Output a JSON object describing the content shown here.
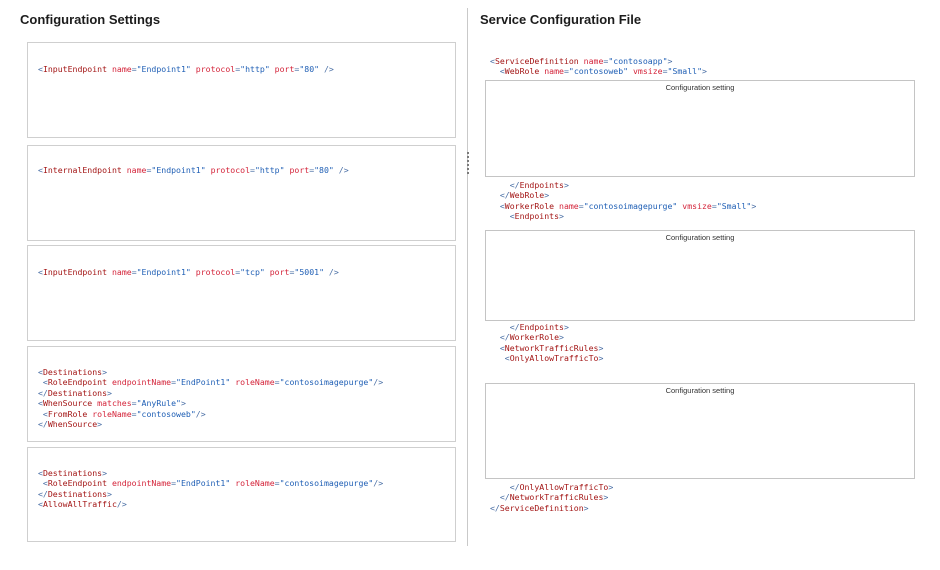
{
  "left_panel": {
    "title": "Configuration Settings",
    "tiles": [
      {
        "lines": [
          [
            {
              "c": "p",
              "t": "<"
            },
            {
              "c": "t",
              "t": "InputEndpoint"
            },
            {
              "c": "a",
              "t": " name"
            },
            {
              "c": "p",
              "t": "="
            },
            {
              "c": "v",
              "t": "\"Endpoint1\""
            },
            {
              "c": "a",
              "t": " protocol"
            },
            {
              "c": "p",
              "t": "="
            },
            {
              "c": "v",
              "t": "\"http\""
            },
            {
              "c": "a",
              "t": " port"
            },
            {
              "c": "p",
              "t": "="
            },
            {
              "c": "v",
              "t": "\"80\""
            },
            {
              "c": "p",
              "t": " />"
            }
          ]
        ]
      },
      {
        "lines": [
          [
            {
              "c": "p",
              "t": "<"
            },
            {
              "c": "t",
              "t": "InternalEndpoint"
            },
            {
              "c": "a",
              "t": " name"
            },
            {
              "c": "p",
              "t": "="
            },
            {
              "c": "v",
              "t": "\"Endpoint1\""
            },
            {
              "c": "a",
              "t": " protocol"
            },
            {
              "c": "p",
              "t": "="
            },
            {
              "c": "v",
              "t": "\"http\""
            },
            {
              "c": "a",
              "t": " port"
            },
            {
              "c": "p",
              "t": "="
            },
            {
              "c": "v",
              "t": "\"80\""
            },
            {
              "c": "p",
              "t": " />"
            }
          ]
        ]
      },
      {
        "lines": [
          [
            {
              "c": "p",
              "t": "<"
            },
            {
              "c": "t",
              "t": "InputEndpoint"
            },
            {
              "c": "a",
              "t": " name"
            },
            {
              "c": "p",
              "t": "="
            },
            {
              "c": "v",
              "t": "\"Endpoint1\""
            },
            {
              "c": "a",
              "t": " protocol"
            },
            {
              "c": "p",
              "t": "="
            },
            {
              "c": "v",
              "t": "\"tcp\""
            },
            {
              "c": "a",
              "t": " port"
            },
            {
              "c": "p",
              "t": "="
            },
            {
              "c": "v",
              "t": "\"5001\""
            },
            {
              "c": "p",
              "t": " />"
            }
          ]
        ]
      },
      {
        "lines": [
          [
            {
              "c": "p",
              "t": "<"
            },
            {
              "c": "t",
              "t": "Destinations"
            },
            {
              "c": "p",
              "t": ">"
            }
          ],
          [
            {
              "c": "p",
              "t": " <"
            },
            {
              "c": "t",
              "t": "RoleEndpoint"
            },
            {
              "c": "a",
              "t": " endpointName"
            },
            {
              "c": "p",
              "t": "="
            },
            {
              "c": "v",
              "t": "\"EndPoint1\""
            },
            {
              "c": "a",
              "t": " roleName"
            },
            {
              "c": "p",
              "t": "="
            },
            {
              "c": "v",
              "t": "\"contosoimagepurge\""
            },
            {
              "c": "p",
              "t": "/>"
            }
          ],
          [
            {
              "c": "p",
              "t": "</"
            },
            {
              "c": "t",
              "t": "Destinations"
            },
            {
              "c": "p",
              "t": ">"
            }
          ],
          [
            {
              "c": "p",
              "t": "<"
            },
            {
              "c": "t",
              "t": "WhenSource"
            },
            {
              "c": "a",
              "t": " matches"
            },
            {
              "c": "p",
              "t": "="
            },
            {
              "c": "v",
              "t": "\"AnyRule\""
            },
            {
              "c": "p",
              "t": ">"
            }
          ],
          [
            {
              "c": "p",
              "t": " <"
            },
            {
              "c": "t",
              "t": "FromRole"
            },
            {
              "c": "a",
              "t": " roleName"
            },
            {
              "c": "p",
              "t": "="
            },
            {
              "c": "v",
              "t": "\"contosoweb\""
            },
            {
              "c": "p",
              "t": "/>"
            }
          ],
          [
            {
              "c": "p",
              "t": "</"
            },
            {
              "c": "t",
              "t": "WhenSource"
            },
            {
              "c": "p",
              "t": ">"
            }
          ]
        ]
      },
      {
        "lines": [
          [
            {
              "c": "p",
              "t": "<"
            },
            {
              "c": "t",
              "t": "Destinations"
            },
            {
              "c": "p",
              "t": ">"
            }
          ],
          [
            {
              "c": "p",
              "t": " <"
            },
            {
              "c": "t",
              "t": "RoleEndpoint"
            },
            {
              "c": "a",
              "t": " endpointName"
            },
            {
              "c": "p",
              "t": "="
            },
            {
              "c": "v",
              "t": "\"EndPoint1\""
            },
            {
              "c": "a",
              "t": " roleName"
            },
            {
              "c": "p",
              "t": "="
            },
            {
              "c": "v",
              "t": "\"contosoimagepurge\""
            },
            {
              "c": "p",
              "t": "/>"
            }
          ],
          [
            {
              "c": "p",
              "t": "</"
            },
            {
              "c": "t",
              "t": "Destinations"
            },
            {
              "c": "p",
              "t": ">"
            }
          ],
          [
            {
              "c": "p",
              "t": "<"
            },
            {
              "c": "t",
              "t": "AllowAllTraffic"
            },
            {
              "c": "p",
              "t": "/>"
            }
          ]
        ]
      }
    ]
  },
  "right_panel": {
    "title": "Service Configuration File",
    "slot_label": "Configuration setting",
    "code_blocks": [
      {
        "lines": [
          [
            {
              "c": "p",
              "t": "<"
            },
            {
              "c": "t",
              "t": "ServiceDefinition"
            },
            {
              "c": "a",
              "t": " name"
            },
            {
              "c": "p",
              "t": "="
            },
            {
              "c": "v",
              "t": "\"contosoapp\""
            },
            {
              "c": "p",
              "t": ">"
            }
          ],
          [
            {
              "c": "p",
              "t": "  <"
            },
            {
              "c": "t",
              "t": "WebRole"
            },
            {
              "c": "a",
              "t": " name"
            },
            {
              "c": "p",
              "t": "="
            },
            {
              "c": "v",
              "t": "\"contosoweb\""
            },
            {
              "c": "a",
              "t": " vmsize"
            },
            {
              "c": "p",
              "t": "="
            },
            {
              "c": "v",
              "t": "\"Small\""
            },
            {
              "c": "p",
              "t": ">"
            }
          ]
        ]
      },
      {
        "lines": [
          [
            {
              "c": "p",
              "t": "    </"
            },
            {
              "c": "t",
              "t": "Endpoints"
            },
            {
              "c": "p",
              "t": ">"
            }
          ],
          [
            {
              "c": "p",
              "t": "  </"
            },
            {
              "c": "t",
              "t": "WebRole"
            },
            {
              "c": "p",
              "t": ">"
            }
          ],
          [
            {
              "c": "p",
              "t": "  <"
            },
            {
              "c": "t",
              "t": "WorkerRole"
            },
            {
              "c": "a",
              "t": " name"
            },
            {
              "c": "p",
              "t": "="
            },
            {
              "c": "v",
              "t": "\"contosoimagepurge\""
            },
            {
              "c": "a",
              "t": " vmsize"
            },
            {
              "c": "p",
              "t": "="
            },
            {
              "c": "v",
              "t": "\"Small\""
            },
            {
              "c": "p",
              "t": ">"
            }
          ],
          [
            {
              "c": "p",
              "t": "    <"
            },
            {
              "c": "t",
              "t": "Endpoints"
            },
            {
              "c": "p",
              "t": ">"
            }
          ]
        ]
      },
      {
        "lines": [
          [
            {
              "c": "p",
              "t": "    </"
            },
            {
              "c": "t",
              "t": "Endpoints"
            },
            {
              "c": "p",
              "t": ">"
            }
          ],
          [
            {
              "c": "p",
              "t": "  </"
            },
            {
              "c": "t",
              "t": "WorkerRole"
            },
            {
              "c": "p",
              "t": ">"
            }
          ],
          [
            {
              "c": "p",
              "t": "  <"
            },
            {
              "c": "t",
              "t": "NetworkTrafficRules"
            },
            {
              "c": "p",
              "t": ">"
            }
          ],
          [
            {
              "c": "p",
              "t": "   <"
            },
            {
              "c": "t",
              "t": "OnlyAllowTrafficTo"
            },
            {
              "c": "p",
              "t": ">"
            }
          ]
        ]
      },
      {
        "lines": [
          [
            {
              "c": "p",
              "t": "    </"
            },
            {
              "c": "t",
              "t": "OnlyAllowTrafficTo"
            },
            {
              "c": "p",
              "t": ">"
            }
          ],
          [
            {
              "c": "p",
              "t": "  </"
            },
            {
              "c": "t",
              "t": "NetworkTrafficRules"
            },
            {
              "c": "p",
              "t": ">"
            }
          ],
          [
            {
              "c": "p",
              "t": "</"
            },
            {
              "c": "t",
              "t": "ServiceDefinition"
            },
            {
              "c": "p",
              "t": ">"
            }
          ]
        ]
      }
    ]
  }
}
